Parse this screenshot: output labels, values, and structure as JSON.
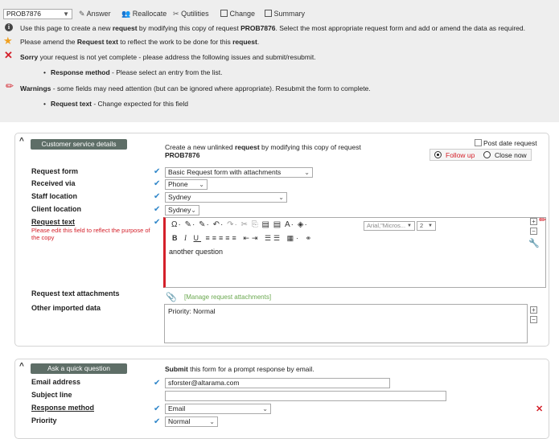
{
  "toolbar": {
    "request_id": "PROB7876",
    "answer": "Answer",
    "reallocate": "Reallocate",
    "qutilities": "Qutilities",
    "change": "Change",
    "summary": "Summary"
  },
  "messages": {
    "info_pre": "Use this page to create a new ",
    "info_b1": "request",
    "info_mid": " by modifying this copy of request ",
    "info_b2": "PROB7876",
    "info_post": ". Select the most appropriate request form and add or amend the data as required.",
    "star_pre": "Please amend the ",
    "star_b1": "Request text",
    "star_mid": " to reflect the work to be done for this ",
    "star_b2": "request",
    "star_post": ".",
    "error_b": "Sorry",
    "error_post": " your request is not yet complete - please address the following issues and submit/resubmit.",
    "error_item_b": "Response method",
    "error_item_post": " - Please select an entry from the list.",
    "warn_b": "Warnings",
    "warn_post": " - some fields may need attention (but can be ignored where appropriate). Resubmit the form to complete.",
    "warn_item_b": "Request text",
    "warn_item_post": " - Change expected for this field"
  },
  "customer": {
    "section_label": "Customer service details",
    "intro_pre": "Create a new unlinked ",
    "intro_b": "request",
    "intro_post": " by modifying this copy of request",
    "intro_id": "PROB7876",
    "post_date_label": "Post date request",
    "follow_up_label": "Follow up",
    "close_now_label": "Close now",
    "request_form_label": "Request form",
    "request_form_value": "Basic Request form with attachments",
    "received_via_label": "Received via",
    "received_via_value": "Phone",
    "staff_location_label": "Staff location",
    "staff_location_value": "Sydney",
    "client_location_label": "Client location",
    "client_location_value": "Sydney",
    "request_text_label": "Request text",
    "request_text_hint": "Please edit this field to reflect the purpose of the copy",
    "editor_font": "Arial,\"Micros...",
    "editor_size": "2",
    "editor_content": "another question",
    "attachments_label": "Request text attachments",
    "attachments_link": "[Manage request attachments]",
    "other_data_label": "Other imported data",
    "other_data_value": "Priority: Normal"
  },
  "quick": {
    "section_label": "Ask a quick question",
    "intro_b": "Submit",
    "intro_post": " this form for a prompt response by email.",
    "email_label": "Email address",
    "email_value": "sforster@altarama.com",
    "subject_label": "Subject line",
    "subject_value": "",
    "response_label": "Response method",
    "response_value": "Email",
    "priority_label": "Priority",
    "priority_value": "Normal"
  },
  "colors": {
    "accent_blue": "#2f86c9",
    "error_red": "#d4202a",
    "section_btn": "#5e6e67",
    "banner_bg": "#eeeeee"
  }
}
